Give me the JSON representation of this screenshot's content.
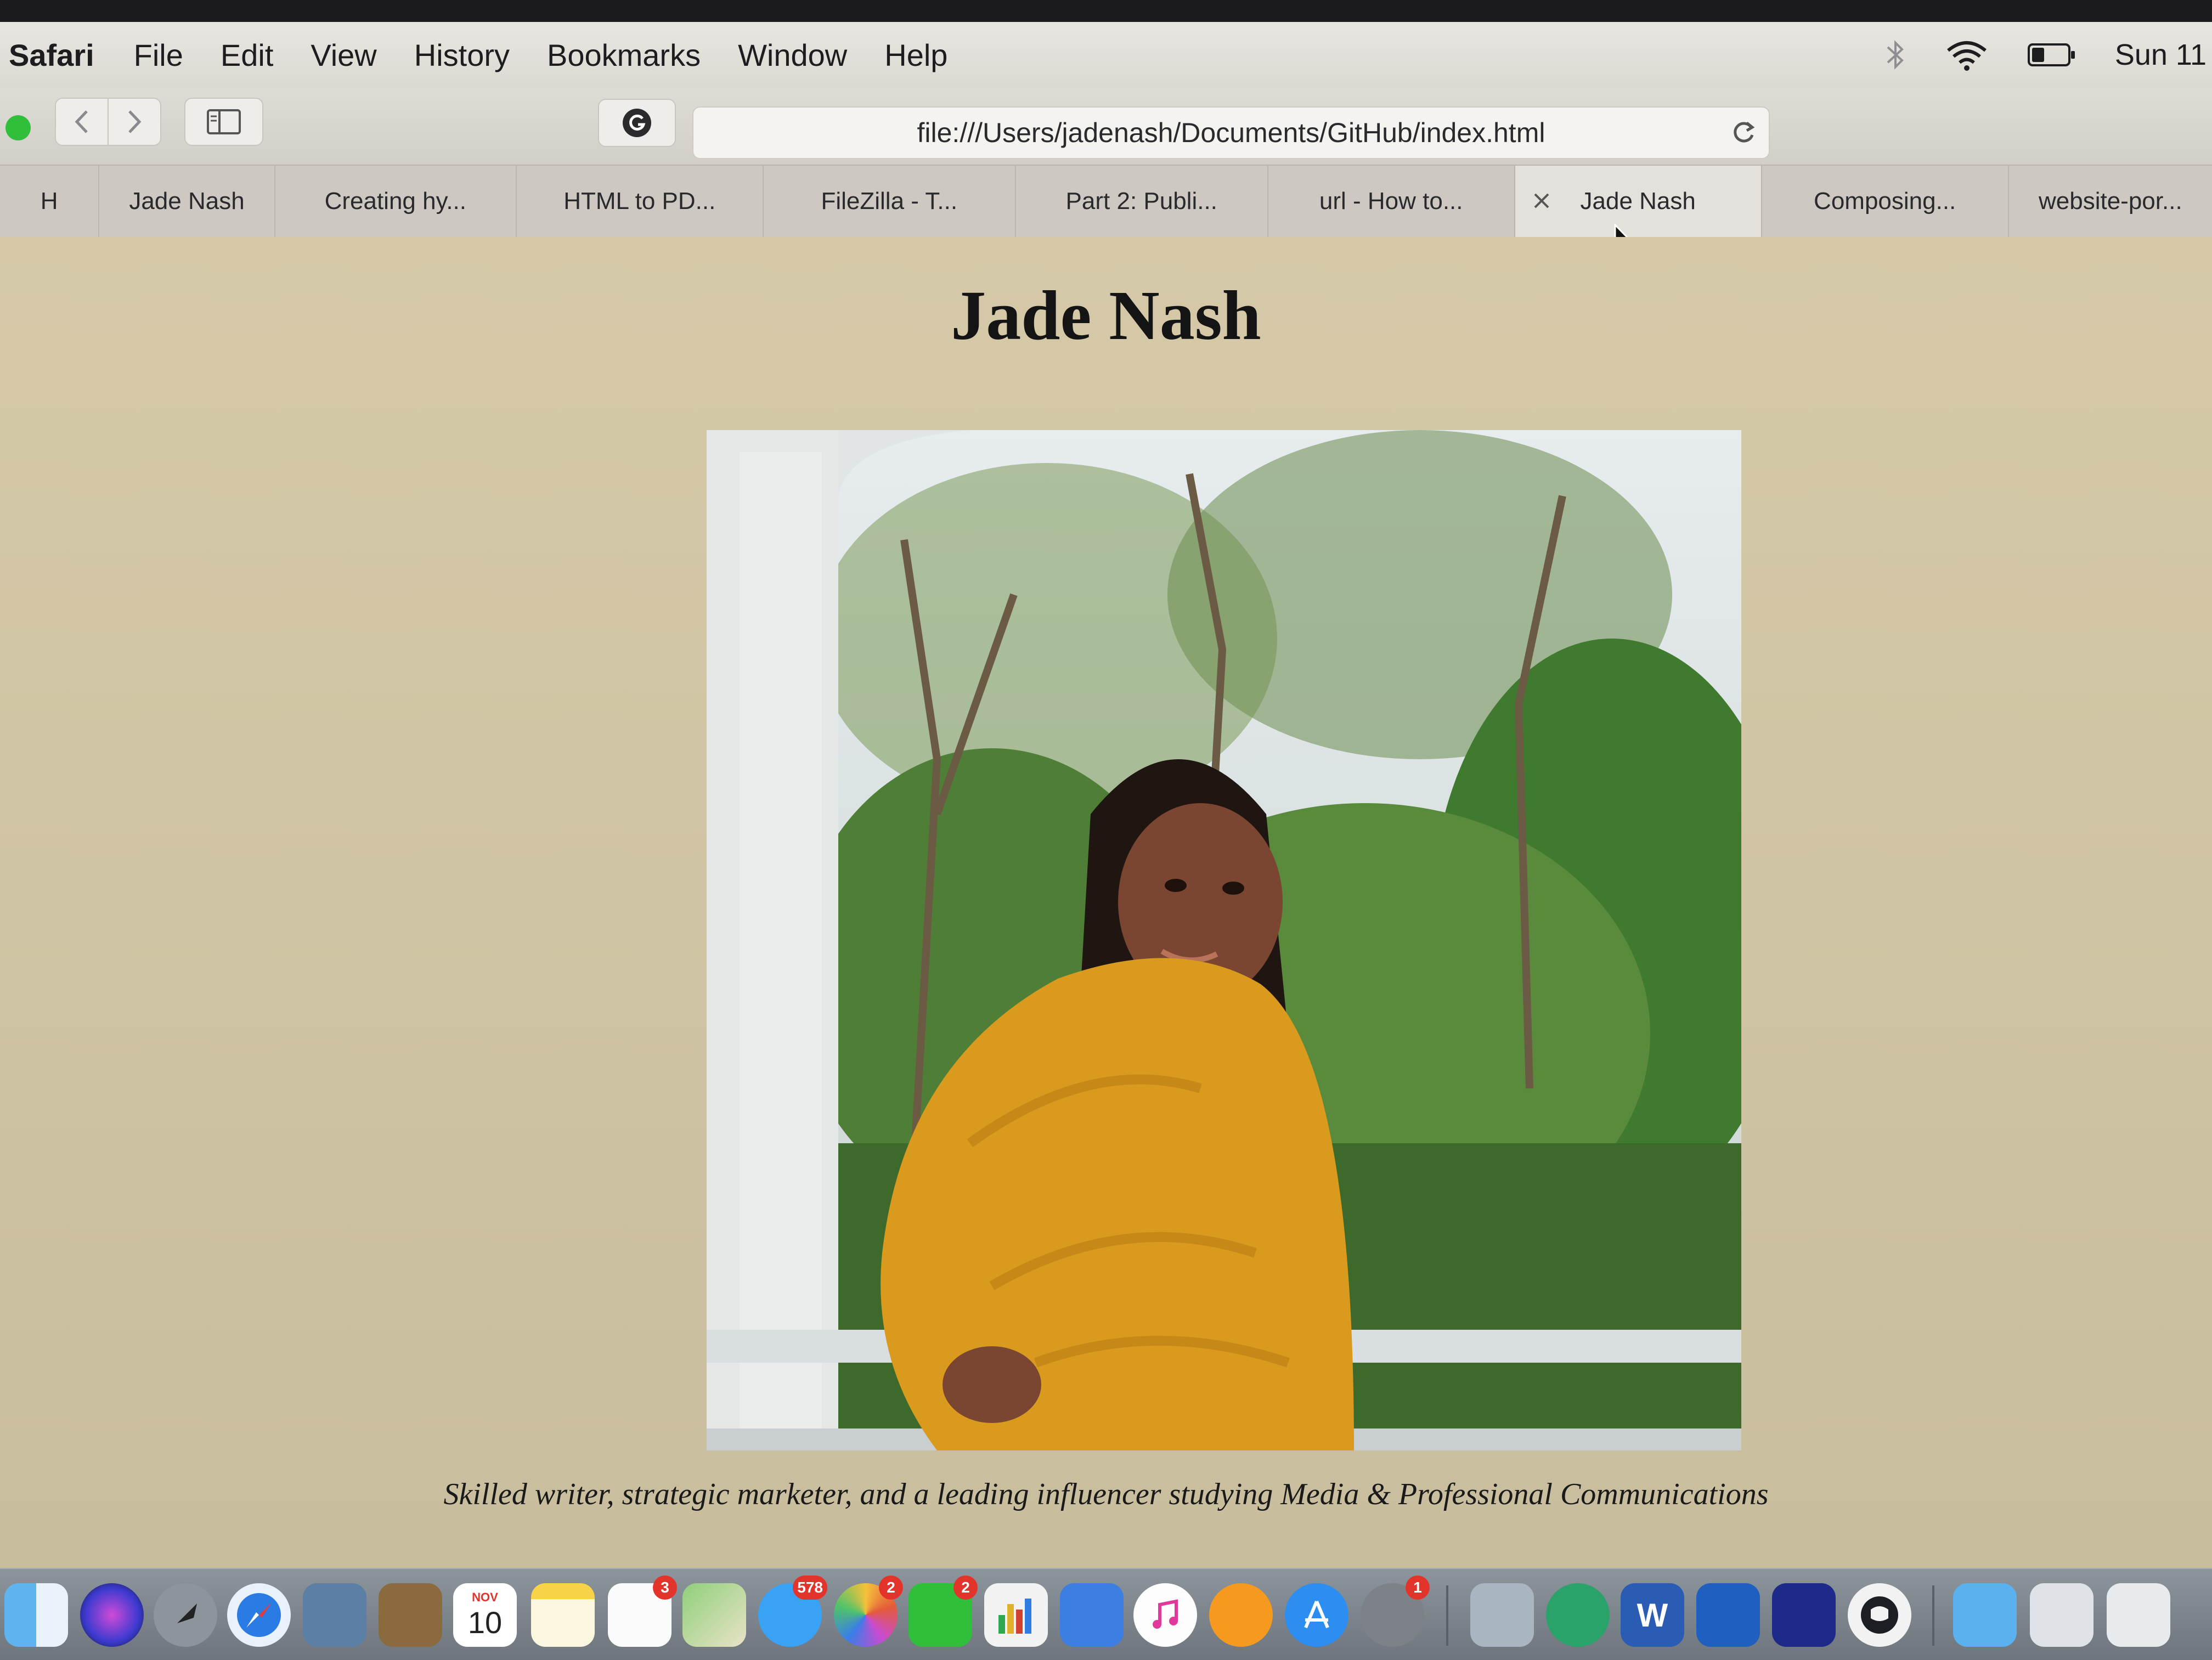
{
  "menubar": {
    "app_name": "Safari",
    "items": [
      "File",
      "Edit",
      "View",
      "History",
      "Bookmarks",
      "Window",
      "Help"
    ],
    "clock": "Sun 11"
  },
  "toolbar": {
    "url": "file:///Users/jadenash/Documents/GitHub/index.html"
  },
  "tabs": [
    {
      "label": "H"
    },
    {
      "label": "Jade Nash"
    },
    {
      "label": "Creating hy..."
    },
    {
      "label": "HTML to PD..."
    },
    {
      "label": "FileZilla - T..."
    },
    {
      "label": "Part 2: Publi..."
    },
    {
      "label": "url - How to..."
    },
    {
      "label": "Jade Nash",
      "active": true
    },
    {
      "label": "Composing..."
    },
    {
      "label": "website-por..."
    }
  ],
  "page": {
    "title": "Jade Nash",
    "tagline": "Skilled writer, strategic marketer, and a leading influencer studying Media & Professional Communications"
  },
  "dock": {
    "calendar_month": "NOV",
    "calendar_day": "10",
    "badges": {
      "reminders": "3",
      "messages": "578",
      "photos": "2",
      "facetime": "2",
      "system_prefs": "1"
    },
    "word_letter": "W",
    "icons": [
      "finder-icon",
      "siri-icon",
      "launchpad-icon",
      "safari-icon",
      "preview-icon",
      "notebook-icon",
      "calendar-icon",
      "notes-icon",
      "reminders-icon",
      "maps-icon",
      "messages-icon",
      "photos-icon",
      "facetime-icon",
      "numbers-icon",
      "keynote-icon",
      "itunes-icon",
      "books-icon",
      "app-store-icon",
      "system-preferences-icon",
      "image-capture-icon",
      "atom-icon",
      "word-icon",
      "box-icon",
      "flow-icon",
      "github-icon",
      "folder-icon",
      "documents-icon"
    ]
  },
  "colors": {
    "page_background": "#d5c9a8",
    "sweater": "#d99a1e",
    "accent_green": "#2fbf3a"
  }
}
